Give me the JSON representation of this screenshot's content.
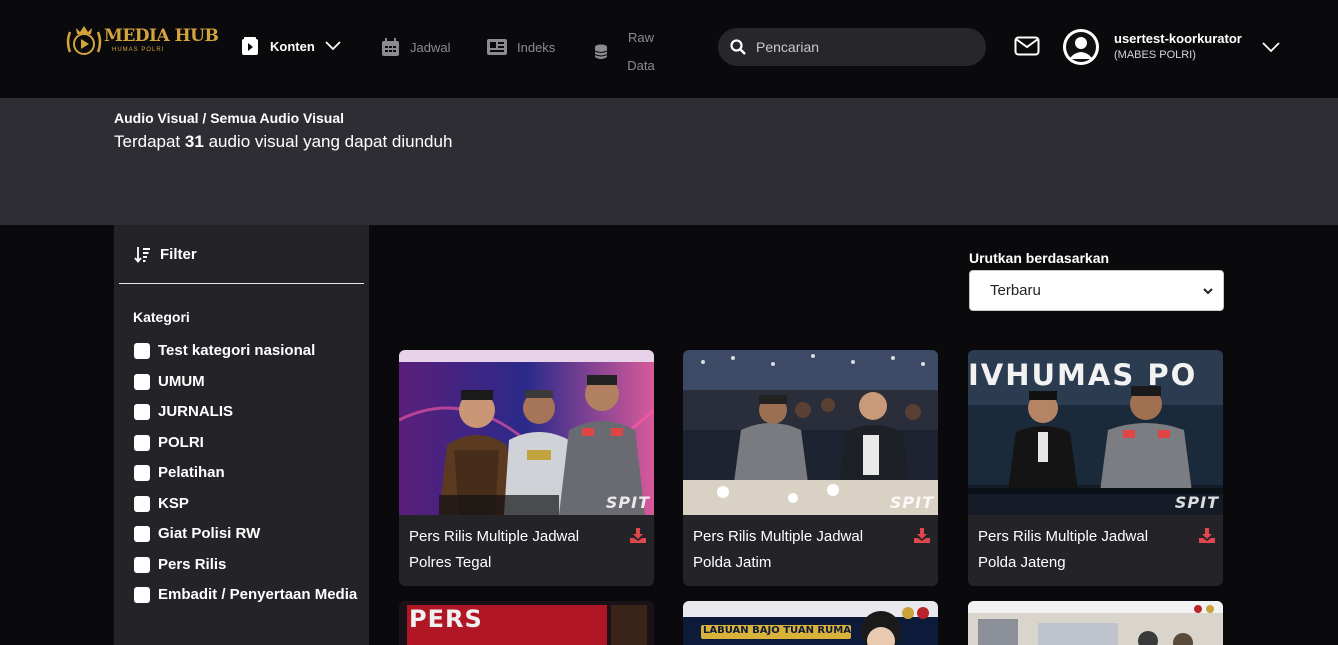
{
  "logo": {
    "text": "MEDIA HUB",
    "sub": "HUMAS POLRI"
  },
  "nav": {
    "konten": "Konten",
    "jadwal": "Jadwal",
    "indeks": "Indeks",
    "raw_line1": "Raw",
    "raw_line2": "Data"
  },
  "search": {
    "placeholder": "Pencarian"
  },
  "user": {
    "name": "usertest-koorkurator",
    "org": "(MABES POLRI)"
  },
  "header": {
    "breadcrumb": "Audio Visual / Semua Audio Visual",
    "count_prefix": "Terdapat",
    "count": "31",
    "count_suffix": "audio visual yang dapat diunduh"
  },
  "filter": {
    "title": "Filter",
    "section": "Kategori",
    "categories": [
      "Test kategori nasional",
      "UMUM",
      "JURNALIS",
      "POLRI",
      "Pelatihan",
      "KSP",
      "Giat Polisi RW",
      "Pers Rilis",
      "Embadit / Penyertaan Media"
    ]
  },
  "sort": {
    "label": "Urutkan berdasarkan",
    "selected": "Terbaru"
  },
  "cards": [
    {
      "title": "Pers Rilis Multiple Jadwal Polres Tegal",
      "watermark": "SPIT"
    },
    {
      "title": "Pers Rilis Multiple Jadwal Polda Jatim",
      "watermark": "SPIT"
    },
    {
      "title": "Pers Rilis Multiple Jadwal Polda Jateng",
      "watermark": "SPIT",
      "banner": "IVHUMAS PO"
    }
  ],
  "partial_cards": [
    {
      "text": "PERS"
    },
    {
      "text": "LABUAN BAJO TUAN RUMAH"
    },
    {
      "text": ""
    }
  ],
  "colors": {
    "background": "#0a090c",
    "band": "#2e2d33",
    "panel": "#242328",
    "accent_gold": "#d4a43c",
    "download_red": "#e0474c"
  }
}
